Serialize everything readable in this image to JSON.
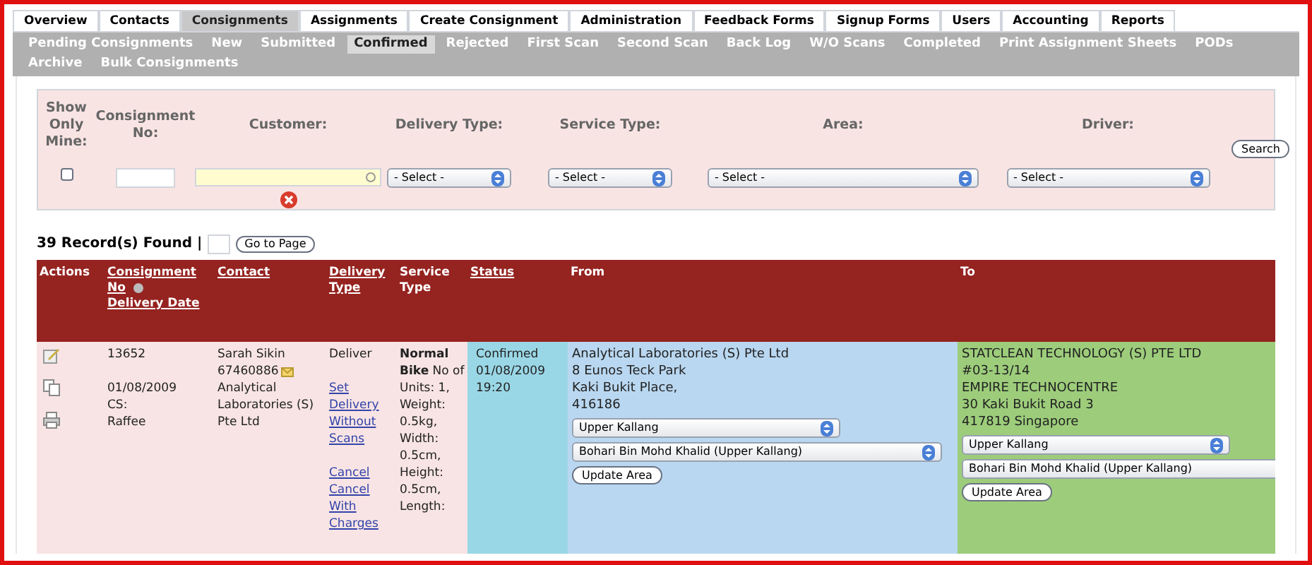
{
  "tabs": [
    {
      "label": "Overview",
      "selected": false
    },
    {
      "label": "Contacts",
      "selected": false
    },
    {
      "label": "Consignments",
      "selected": true
    },
    {
      "label": "Assignments",
      "selected": false
    },
    {
      "label": "Create Consignment",
      "selected": false
    },
    {
      "label": "Administration",
      "selected": false
    },
    {
      "label": "Feedback Forms",
      "selected": false
    },
    {
      "label": "Signup Forms",
      "selected": false
    },
    {
      "label": "Users",
      "selected": false
    },
    {
      "label": "Accounting",
      "selected": false
    },
    {
      "label": "Reports",
      "selected": false
    }
  ],
  "subnav": [
    {
      "label": "Pending Consignments",
      "selected": false
    },
    {
      "label": "New",
      "selected": false
    },
    {
      "label": "Submitted",
      "selected": false
    },
    {
      "label": "Confirmed",
      "selected": true
    },
    {
      "label": "Rejected",
      "selected": false
    },
    {
      "label": "First Scan",
      "selected": false
    },
    {
      "label": "Second Scan",
      "selected": false
    },
    {
      "label": "Back Log",
      "selected": false
    },
    {
      "label": "W/O Scans",
      "selected": false
    },
    {
      "label": "Completed",
      "selected": false
    },
    {
      "label": "Print Assignment Sheets",
      "selected": false
    },
    {
      "label": "PODs",
      "selected": false
    },
    {
      "label": "Archive",
      "selected": false
    },
    {
      "label": "Bulk Consignments",
      "selected": false
    }
  ],
  "filters": [
    {
      "kind": "checkbox",
      "label": "Show Only Mine:",
      "checked": false
    },
    {
      "kind": "text",
      "label": "Consignment No:"
    },
    {
      "kind": "customer",
      "label": "Customer:"
    },
    {
      "kind": "select",
      "label": "Delivery Type:",
      "value": "- Select -"
    },
    {
      "kind": "select",
      "label": "Service Type:",
      "value": "- Select -"
    },
    {
      "kind": "select",
      "label": "Area:",
      "value": "- Select -"
    },
    {
      "kind": "select",
      "label": "Driver:",
      "value": "- Select -"
    }
  ],
  "search_button": "Search",
  "records": {
    "text": "39 Record(s) Found |",
    "go_button": "Go to Page"
  },
  "table": {
    "columns": [
      {
        "label": "Actions",
        "sortable": false
      },
      {
        "label": "Consignment No",
        "sortable": true,
        "sub_label": "Delivery Date"
      },
      {
        "label": "Contact",
        "sortable": true
      },
      {
        "label": "Delivery Type",
        "sortable": true
      },
      {
        "label": "Service Type",
        "sortable": false
      },
      {
        "label": "Status",
        "sortable": true
      },
      {
        "label": "From",
        "sortable": false
      },
      {
        "label": "To",
        "sortable": false
      }
    ],
    "rows": [
      {
        "consignment": [
          "13652",
          "01/08/2009",
          "CS:",
          "Raffee"
        ],
        "contact": {
          "name": "Sarah Sikin",
          "phone": "67460886",
          "company": "Analytical Laboratories (S) Pte Ltd"
        },
        "delivery_type": {
          "text": "Deliver",
          "links": [
            "Set Delivery Without Scans",
            "Cancel",
            "Cancel With Charges"
          ]
        },
        "service_type": "**Normal Bike** No of Units: 1, Weight: 0.5kg, Width: 0.5cm, Height: 0.5cm, Length:",
        "status": [
          "Confirmed",
          "01/08/2009",
          "19:20"
        ],
        "from": {
          "lines": [
            "Analytical Laboratories (S) Pte Ltd",
            "8 Eunos Teck Park",
            "Kaki Bukit Place,",
            "416186"
          ],
          "area": "Upper Kallang",
          "driver": "Bohari Bin Mohd Khalid (Upper Kallang)",
          "button": "Update Area"
        },
        "to": {
          "lines": [
            "STATCLEAN TECHNOLOGY (S) PTE LTD",
            "#03-13/14",
            "EMPIRE TECHNOCENTRE",
            "30 Kaki Bukit Road 3",
            "417819 Singapore"
          ],
          "area": "Upper Kallang",
          "driver": "Bohari Bin Mohd Khalid (Upper Kallang)",
          "button": "Update Area"
        }
      }
    ]
  }
}
